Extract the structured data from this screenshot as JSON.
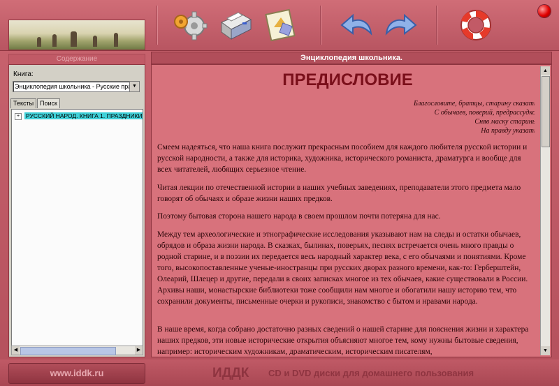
{
  "header": {
    "toolbar": [
      "settings-icon",
      "printer-icon",
      "bookmark-icon",
      "back-icon",
      "forward-icon",
      "help-icon"
    ]
  },
  "left_panel": {
    "title": "Содержание",
    "book_label": "Книга:",
    "book_select_value": "Энциклопедия школьника - Русские пра",
    "tabs": [
      "Тексты",
      "Поиск"
    ],
    "tree": [
      {
        "label": "РУССКИЙ НАРОД.  КНИГА 1. ПРАЗДНИКИ",
        "selected": true
      }
    ]
  },
  "main": {
    "title": "Энциклопедия школьника.",
    "heading": "ПРЕДИСЛОВИЕ",
    "epigraph": [
      "Благословите, братцы, старину сказать,",
      "С обычаев, поверий, предрассудков",
      "Сняв маску старины,",
      "На правду указать."
    ],
    "paragraphs": [
      "Смеем надеяться, что наша книга послужит прекрасным пособием для каждого любителя русской истории и русской народности, а также для историка, художника, исторического романиста, драматурга и вообще для всех читателей, любящих серьезное чтение.",
      "Читая лекции по отечественной истории в наших учебных заведениях, преподаватели этого предмета мало говорят об обычаях и образе жизни наших предков.",
      "Поэтому бытовая сторона нашего народа в своем прошлом почти потеряна для нас.",
      "Между тем археологические и этнографические исследования указывают нам на следы и остатки обычаев, обрядов и образа жизни народа. В сказках, былинах, поверьях, песнях встречается очень много правды о родной старине, и в поэзии их передается весь народный характер века, с его обычаями и понятиями. Кроме того, высокопоставленные ученые-иностранцы при русских дворах разного времени, как-то: Герберштейн, Олеарий, Шлецер и другие, передали в своих записках многое из тех обычаев, какие существовали в России. Архивы наши, монастырские библиотеки тоже сообщили нам многое и обогатили нашу историю тем, что сохранили документы, письменные очерки и рукописи, знакомство с бытом и нравами народа.",
      "В наше время, когда собрано достаточно разных сведений о нашей старине для пояснения жизни и характера наших предков, эти новые исторические открытия объясняют многое тем, кому нужны бытовые сведения, например: историческим художникам, драматическим, историческим писателям,"
    ]
  },
  "footer": {
    "site": "www.iddk.ru",
    "brand": "ИДДК",
    "tagline": "CD и DVD диски для домашнего пользования"
  },
  "colors": {
    "frame": "#c25a66",
    "text_area": "#d8727c",
    "heading": "#7a0f1a",
    "tree_highlight": "#3fd0d8"
  }
}
